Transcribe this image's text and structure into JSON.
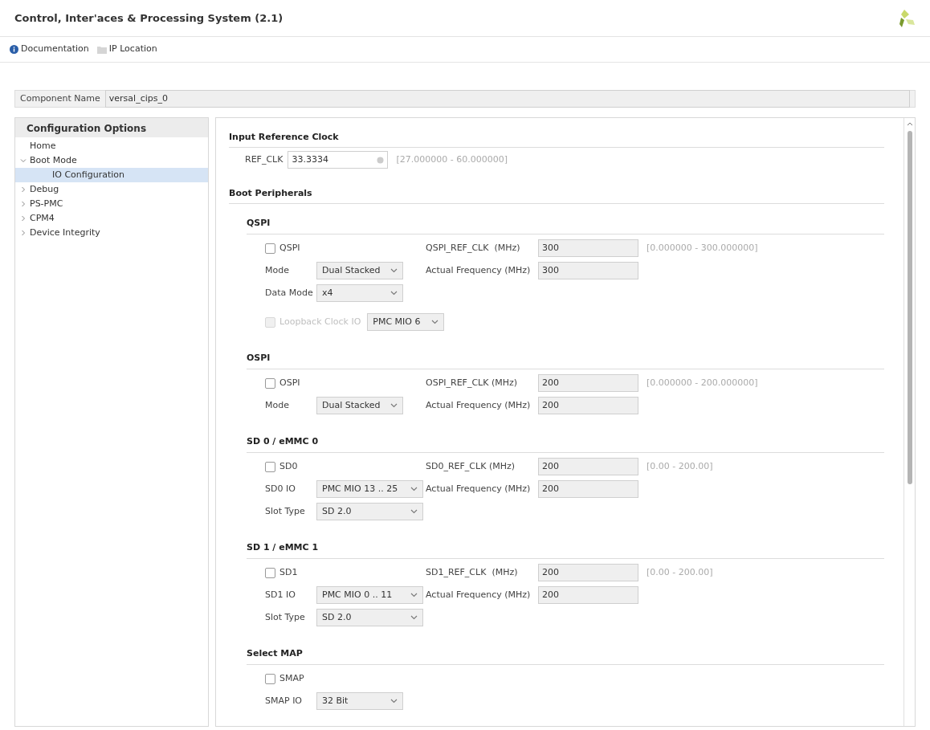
{
  "window": {
    "title": "Control, Inter'aces & Processing System (2.1)"
  },
  "toolbar": [
    {
      "kind": "info",
      "label": "Documentation"
    },
    {
      "kind": "folder",
      "label": "IP Location"
    }
  ],
  "component_name": {
    "label": "Component Name",
    "value": "versal_cips_0"
  },
  "sidebar": {
    "title": "Configuration Options",
    "items": [
      {
        "label": "Home",
        "selected": false
      },
      {
        "label": "Boot Mode",
        "expanded": true,
        "selected": false,
        "children": [
          {
            "label": "IO Configuration",
            "selected": true
          }
        ]
      },
      {
        "label": "Debug",
        "expanded": false,
        "selected": false
      },
      {
        "label": "PS-PMC",
        "expanded": false,
        "selected": false
      },
      {
        "label": "CPM4",
        "expanded": false,
        "selected": false
      },
      {
        "label": "Device Integrity",
        "expanded": false,
        "selected": false
      }
    ]
  },
  "input_reference_clock": {
    "title": "Input Reference Clock",
    "label": "REF_CLK",
    "value": "33.3334",
    "range": "[27.000000 - 60.000000]"
  },
  "boot_peripherals": {
    "title": "Boot Peripherals",
    "sections": [
      {
        "title": "QSPI",
        "checkbox": {
          "label": "QSPI",
          "checked": false
        },
        "selects": [
          {
            "label": "Mode",
            "value": "Dual Stacked"
          },
          {
            "label": "Data Mode",
            "value": "x4"
          }
        ],
        "clock": {
          "label": "QSPI_REF_CLK  (MHz)",
          "value": "300",
          "range": "[0.000000 - 300.000000]"
        },
        "actual": {
          "label": "Actual Frequency (MHz)",
          "value": "300"
        },
        "loopback": {
          "label": "Loopback Clock IO",
          "checked": false,
          "disabled": true,
          "value": "PMC MIO 6"
        }
      },
      {
        "title": "OSPI",
        "checkbox": {
          "label": "OSPI",
          "checked": false
        },
        "selects": [
          {
            "label": "Mode",
            "value": "Dual Stacked"
          }
        ],
        "clock": {
          "label": "OSPI_REF_CLK (MHz)",
          "value": "200",
          "range": "[0.000000 - 200.000000]"
        },
        "actual": {
          "label": "Actual Frequency (MHz)",
          "value": "200"
        }
      },
      {
        "title": "SD 0 / eMMC 0",
        "checkbox": {
          "label": "SD0",
          "checked": false
        },
        "selects": [
          {
            "label": "SD0 IO",
            "value": "PMC MIO 13 .. 25"
          },
          {
            "label": "Slot Type",
            "value": "SD 2.0"
          }
        ],
        "clock": {
          "label": "SD0_REF_CLK (MHz)",
          "value": "200",
          "range": "[0.00 - 200.00]"
        },
        "actual": {
          "label": "Actual Frequency (MHz)",
          "value": "200"
        }
      },
      {
        "title": "SD 1 / eMMC 1",
        "checkbox": {
          "label": "SD1",
          "checked": false
        },
        "selects": [
          {
            "label": "SD1 IO",
            "value": "PMC MIO 0 .. 11"
          },
          {
            "label": "Slot Type",
            "value": "SD 2.0"
          }
        ],
        "clock": {
          "label": "SD1_REF_CLK  (MHz)",
          "value": "200",
          "range": "[0.00 - 200.00]"
        },
        "actual": {
          "label": "Actual Frequency (MHz)",
          "value": "200"
        }
      },
      {
        "title": "Select MAP",
        "checkbox": {
          "label": "SMAP",
          "checked": false
        },
        "selects": [
          {
            "label": "SMAP IO",
            "value": "32 Bit"
          }
        ]
      }
    ]
  }
}
